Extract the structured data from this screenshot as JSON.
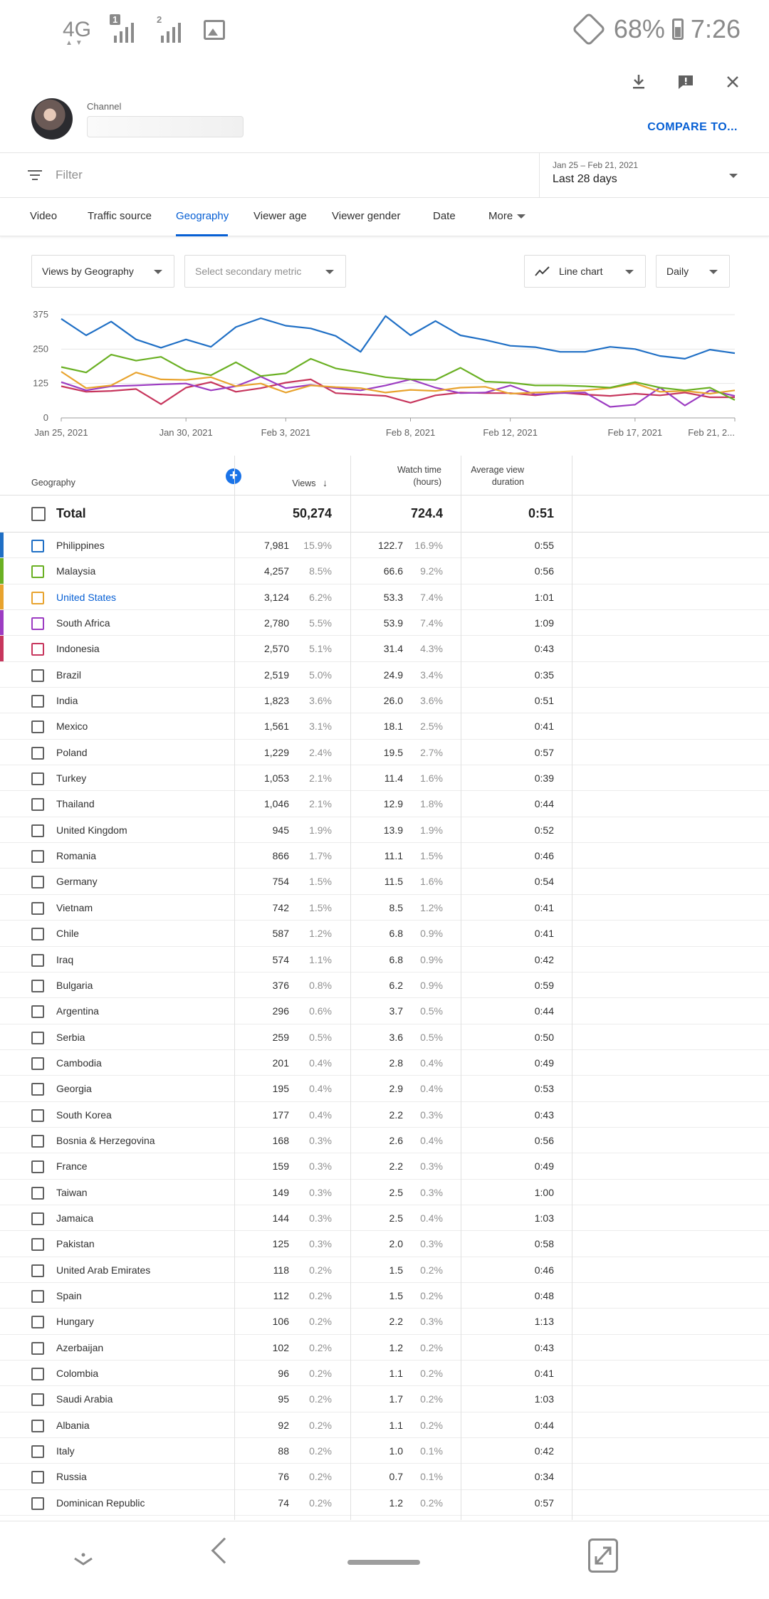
{
  "status_bar": {
    "network": "4G",
    "sim1_badge": "1",
    "sim2_badge": "2",
    "battery": "68%",
    "time": "7:26"
  },
  "header": {
    "channel_label": "Channel",
    "compare_label": "COMPARE TO..."
  },
  "filter": {
    "placeholder": "Filter",
    "date_range": "Jan 25 – Feb 21, 2021",
    "date_preset": "Last 28 days"
  },
  "tabs": [
    {
      "label": "Video"
    },
    {
      "label": "Traffic source"
    },
    {
      "label": "Geography",
      "active": true
    },
    {
      "label": "Viewer age"
    },
    {
      "label": "Viewer gender"
    },
    {
      "label": "Date"
    },
    {
      "label": "More"
    }
  ],
  "controls": {
    "primary_metric": "Views by Geography",
    "secondary_metric": "Select secondary metric",
    "chart_type": "Line chart",
    "granularity": "Daily"
  },
  "chart_data": {
    "type": "line",
    "x": [
      "Jan 25",
      "Jan 26",
      "Jan 27",
      "Jan 28",
      "Jan 29",
      "Jan 30",
      "Jan 31",
      "Feb 1",
      "Feb 2",
      "Feb 3",
      "Feb 4",
      "Feb 5",
      "Feb 6",
      "Feb 7",
      "Feb 8",
      "Feb 9",
      "Feb 10",
      "Feb 11",
      "Feb 12",
      "Feb 13",
      "Feb 14",
      "Feb 15",
      "Feb 16",
      "Feb 17",
      "Feb 18",
      "Feb 19",
      "Feb 20",
      "Feb 21"
    ],
    "x_tick_labels": [
      "Jan 25, 2021",
      "Jan 30, 2021",
      "Feb 3, 2021",
      "Feb 8, 2021",
      "Feb 12, 2021",
      "Feb 17, 2021",
      "Feb 21, 2..."
    ],
    "x_tick_positions": [
      0,
      5,
      9,
      14,
      18,
      23,
      27
    ],
    "y_ticks": [
      0,
      125,
      250,
      375
    ],
    "ylim": [
      0,
      375
    ],
    "grid": true,
    "series": [
      {
        "name": "Philippines",
        "color": "#1f6fc5",
        "values": [
          360,
          300,
          350,
          285,
          255,
          285,
          258,
          330,
          362,
          335,
          325,
          298,
          240,
          370,
          300,
          352,
          300,
          283,
          262,
          257,
          240,
          240,
          258,
          250,
          225,
          215,
          248,
          235
        ]
      },
      {
        "name": "Malaysia",
        "color": "#6ab023",
        "values": [
          185,
          165,
          230,
          208,
          222,
          172,
          155,
          202,
          152,
          162,
          215,
          180,
          165,
          148,
          140,
          138,
          182,
          132,
          128,
          118,
          118,
          115,
          110,
          130,
          110,
          100,
          110,
          65
        ]
      },
      {
        "name": "United States",
        "color": "#e8a32e",
        "values": [
          168,
          108,
          118,
          165,
          140,
          138,
          148,
          115,
          125,
          92,
          118,
          112,
          108,
          92,
          102,
          98,
          110,
          113,
          88,
          92,
          95,
          100,
          108,
          125,
          95,
          98,
          88,
          100
        ]
      },
      {
        "name": "South Africa",
        "color": "#9c3cc2",
        "values": [
          130,
          100,
          115,
          118,
          122,
          125,
          100,
          115,
          150,
          108,
          120,
          108,
          100,
          118,
          140,
          110,
          90,
          92,
          118,
          85,
          90,
          92,
          40,
          48,
          110,
          45,
          100,
          80
        ]
      },
      {
        "name": "Indonesia",
        "color": "#c7365d",
        "values": [
          115,
          95,
          98,
          105,
          50,
          110,
          130,
          95,
          108,
          128,
          140,
          90,
          85,
          80,
          55,
          82,
          92,
          90,
          90,
          82,
          92,
          85,
          80,
          88,
          82,
          92,
          75,
          75
        ]
      }
    ]
  },
  "table": {
    "headers": {
      "geography": "Geography",
      "views": "Views",
      "watch_time_1": "Watch time",
      "watch_time_2": "(hours)",
      "avd_1": "Average view",
      "avd_2": "duration"
    },
    "total": {
      "label": "Total",
      "views": "50,274",
      "watch": "724.4",
      "avd": "0:51"
    },
    "rows": [
      {
        "name": "Philippines",
        "views": "7,981",
        "vp": "15.9%",
        "watch": "122.7",
        "wp": "16.9%",
        "avd": "0:55",
        "color": "#1f6fc5"
      },
      {
        "name": "Malaysia",
        "views": "4,257",
        "vp": "8.5%",
        "watch": "66.6",
        "wp": "9.2%",
        "avd": "0:56",
        "color": "#6ab023"
      },
      {
        "name": "United States",
        "views": "3,124",
        "vp": "6.2%",
        "watch": "53.3",
        "wp": "7.4%",
        "avd": "1:01",
        "color": "#e8a32e",
        "link": true
      },
      {
        "name": "South Africa",
        "views": "2,780",
        "vp": "5.5%",
        "watch": "53.9",
        "wp": "7.4%",
        "avd": "1:09",
        "color": "#9c3cc2"
      },
      {
        "name": "Indonesia",
        "views": "2,570",
        "vp": "5.1%",
        "watch": "31.4",
        "wp": "4.3%",
        "avd": "0:43",
        "color": "#c7365d"
      },
      {
        "name": "Brazil",
        "views": "2,519",
        "vp": "5.0%",
        "watch": "24.9",
        "wp": "3.4%",
        "avd": "0:35"
      },
      {
        "name": "India",
        "views": "1,823",
        "vp": "3.6%",
        "watch": "26.0",
        "wp": "3.6%",
        "avd": "0:51"
      },
      {
        "name": "Mexico",
        "views": "1,561",
        "vp": "3.1%",
        "watch": "18.1",
        "wp": "2.5%",
        "avd": "0:41"
      },
      {
        "name": "Poland",
        "views": "1,229",
        "vp": "2.4%",
        "watch": "19.5",
        "wp": "2.7%",
        "avd": "0:57"
      },
      {
        "name": "Turkey",
        "views": "1,053",
        "vp": "2.1%",
        "watch": "11.4",
        "wp": "1.6%",
        "avd": "0:39"
      },
      {
        "name": "Thailand",
        "views": "1,046",
        "vp": "2.1%",
        "watch": "12.9",
        "wp": "1.8%",
        "avd": "0:44"
      },
      {
        "name": "United Kingdom",
        "views": "945",
        "vp": "1.9%",
        "watch": "13.9",
        "wp": "1.9%",
        "avd": "0:52"
      },
      {
        "name": "Romania",
        "views": "866",
        "vp": "1.7%",
        "watch": "11.1",
        "wp": "1.5%",
        "avd": "0:46"
      },
      {
        "name": "Germany",
        "views": "754",
        "vp": "1.5%",
        "watch": "11.5",
        "wp": "1.6%",
        "avd": "0:54"
      },
      {
        "name": "Vietnam",
        "views": "742",
        "vp": "1.5%",
        "watch": "8.5",
        "wp": "1.2%",
        "avd": "0:41"
      },
      {
        "name": "Chile",
        "views": "587",
        "vp": "1.2%",
        "watch": "6.8",
        "wp": "0.9%",
        "avd": "0:41"
      },
      {
        "name": "Iraq",
        "views": "574",
        "vp": "1.1%",
        "watch": "6.8",
        "wp": "0.9%",
        "avd": "0:42"
      },
      {
        "name": "Bulgaria",
        "views": "376",
        "vp": "0.8%",
        "watch": "6.2",
        "wp": "0.9%",
        "avd": "0:59"
      },
      {
        "name": "Argentina",
        "views": "296",
        "vp": "0.6%",
        "watch": "3.7",
        "wp": "0.5%",
        "avd": "0:44"
      },
      {
        "name": "Serbia",
        "views": "259",
        "vp": "0.5%",
        "watch": "3.6",
        "wp": "0.5%",
        "avd": "0:50"
      },
      {
        "name": "Cambodia",
        "views": "201",
        "vp": "0.4%",
        "watch": "2.8",
        "wp": "0.4%",
        "avd": "0:49"
      },
      {
        "name": "Georgia",
        "views": "195",
        "vp": "0.4%",
        "watch": "2.9",
        "wp": "0.4%",
        "avd": "0:53"
      },
      {
        "name": "South Korea",
        "views": "177",
        "vp": "0.4%",
        "watch": "2.2",
        "wp": "0.3%",
        "avd": "0:43"
      },
      {
        "name": "Bosnia & Herzegovina",
        "views": "168",
        "vp": "0.3%",
        "watch": "2.6",
        "wp": "0.4%",
        "avd": "0:56"
      },
      {
        "name": "France",
        "views": "159",
        "vp": "0.3%",
        "watch": "2.2",
        "wp": "0.3%",
        "avd": "0:49"
      },
      {
        "name": "Taiwan",
        "views": "149",
        "vp": "0.3%",
        "watch": "2.5",
        "wp": "0.3%",
        "avd": "1:00"
      },
      {
        "name": "Jamaica",
        "views": "144",
        "vp": "0.3%",
        "watch": "2.5",
        "wp": "0.4%",
        "avd": "1:03"
      },
      {
        "name": "Pakistan",
        "views": "125",
        "vp": "0.3%",
        "watch": "2.0",
        "wp": "0.3%",
        "avd": "0:58"
      },
      {
        "name": "United Arab Emirates",
        "views": "118",
        "vp": "0.2%",
        "watch": "1.5",
        "wp": "0.2%",
        "avd": "0:46"
      },
      {
        "name": "Spain",
        "views": "112",
        "vp": "0.2%",
        "watch": "1.5",
        "wp": "0.2%",
        "avd": "0:48"
      },
      {
        "name": "Hungary",
        "views": "106",
        "vp": "0.2%",
        "watch": "2.2",
        "wp": "0.3%",
        "avd": "1:13"
      },
      {
        "name": "Azerbaijan",
        "views": "102",
        "vp": "0.2%",
        "watch": "1.2",
        "wp": "0.2%",
        "avd": "0:43"
      },
      {
        "name": "Colombia",
        "views": "96",
        "vp": "0.2%",
        "watch": "1.1",
        "wp": "0.2%",
        "avd": "0:41"
      },
      {
        "name": "Saudi Arabia",
        "views": "95",
        "vp": "0.2%",
        "watch": "1.7",
        "wp": "0.2%",
        "avd": "1:03"
      },
      {
        "name": "Albania",
        "views": "92",
        "vp": "0.2%",
        "watch": "1.1",
        "wp": "0.2%",
        "avd": "0:44"
      },
      {
        "name": "Italy",
        "views": "88",
        "vp": "0.2%",
        "watch": "1.0",
        "wp": "0.1%",
        "avd": "0:42"
      },
      {
        "name": "Russia",
        "views": "76",
        "vp": "0.2%",
        "watch": "0.7",
        "wp": "0.1%",
        "avd": "0:34"
      },
      {
        "name": "Dominican Republic",
        "views": "74",
        "vp": "0.2%",
        "watch": "1.2",
        "wp": "0.2%",
        "avd": "0:57"
      }
    ]
  }
}
